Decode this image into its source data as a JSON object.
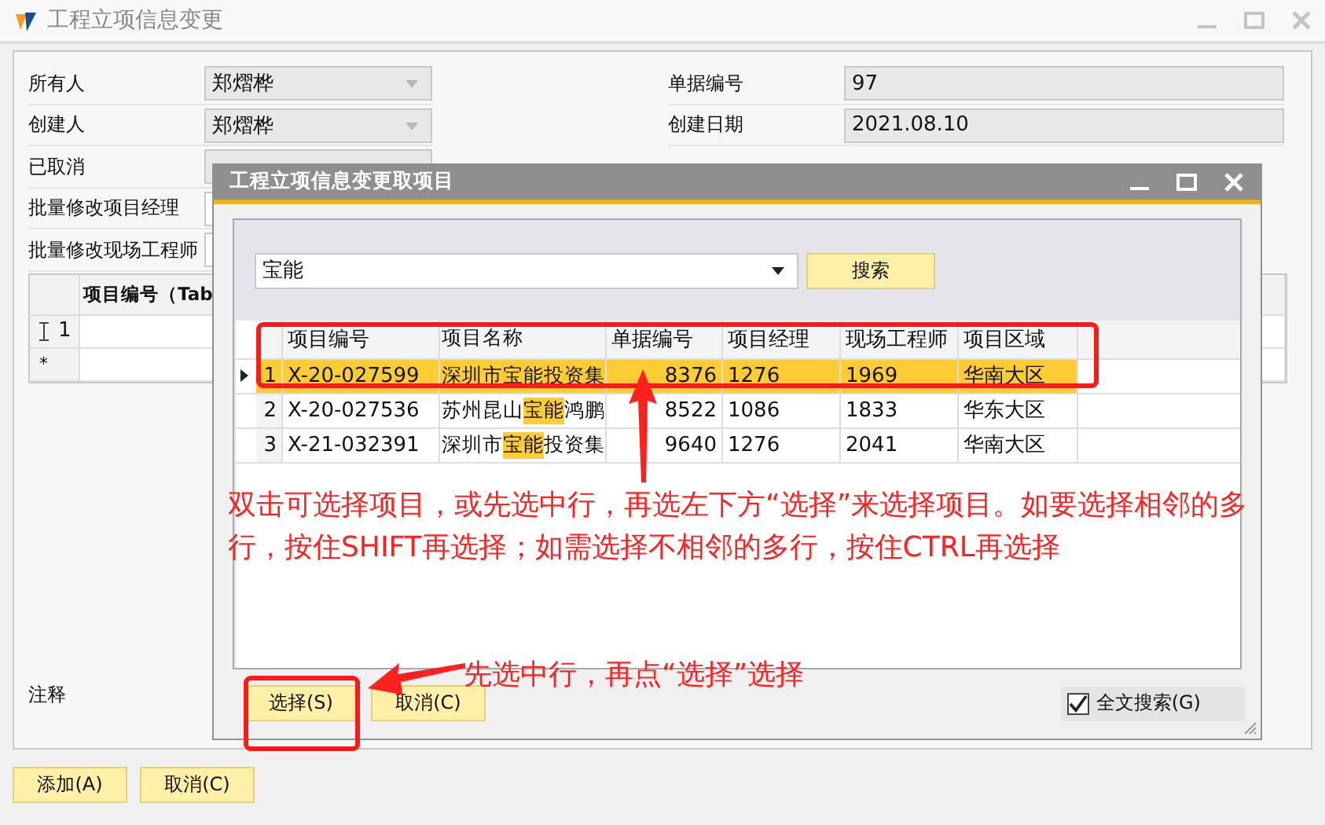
{
  "window": {
    "title": "工程立项信息变更"
  },
  "form": {
    "left": [
      {
        "label": "所有人",
        "value": "郑熠桦",
        "kind": "dropdown"
      },
      {
        "label": "创建人",
        "value": "郑熠桦",
        "kind": "dropdown"
      },
      {
        "label": "已取消",
        "kind": "text"
      },
      {
        "label": "批量修改项目经理",
        "kind": "text"
      },
      {
        "label": "批量修改现场工程师",
        "kind": "text"
      }
    ],
    "right": [
      {
        "label": "单据编号",
        "value": "97"
      },
      {
        "label": "创建日期",
        "value": "2021.08.10"
      }
    ]
  },
  "grid": {
    "columns": [
      "项目编号（Tab"
    ],
    "rows": [
      {
        "kind": "editing",
        "number": "1"
      },
      {
        "kind": "new",
        "marker": "*"
      }
    ]
  },
  "notes_label": "注释",
  "buttons": [
    "添加(A)",
    "取消(C)"
  ],
  "dialog": {
    "title": "工程立项信息变更取项目",
    "search": {
      "value": "宝能"
    },
    "search_button": "搜索",
    "table": {
      "columns": [
        "项目编号",
        "项目名称",
        "单据编号",
        "项目经理",
        "现场工程师",
        "项目区域"
      ],
      "rows": [
        {
          "selected": true,
          "number": "1",
          "code": "X-20-027599",
          "name": "深圳市宝能投资集",
          "doc": "8376",
          "manager": "1276",
          "engineer": "1969",
          "region": "华南大区"
        },
        {
          "selected": false,
          "number": "2",
          "code": "X-20-027536",
          "name": [
            {
              "text": "苏州昆山",
              "match": false
            },
            {
              "text": "宝能",
              "match": true
            },
            {
              "text": "鸿鹏",
              "match": false
            }
          ],
          "doc": "8522",
          "manager": "1086",
          "engineer": "1833",
          "region": "华东大区"
        },
        {
          "selected": false,
          "number": "3",
          "code": "X-21-032391",
          "name": [
            {
              "text": "深圳市",
              "match": false
            },
            {
              "text": "宝能",
              "match": true
            },
            {
              "text": "投资集",
              "match": false
            }
          ],
          "doc": "9640",
          "manager": "1276",
          "engineer": "2041",
          "region": "华南大区"
        }
      ]
    },
    "buttons": [
      "选择(S)",
      "取消(C)"
    ],
    "fulltext": {
      "label": "全文搜索(G)",
      "checked": true
    }
  },
  "annotations": [
    {
      "kind": "note",
      "text": "双击可选择项目，或先选中行，再选左下方“选择”来选择项目。如要选择相邻的多行，按住SHIFT再选择；如需选择不相邻的多行，按住CTRL再选择"
    },
    {
      "kind": "hint",
      "text": "先选中行，再点“选择”选择"
    }
  ]
}
